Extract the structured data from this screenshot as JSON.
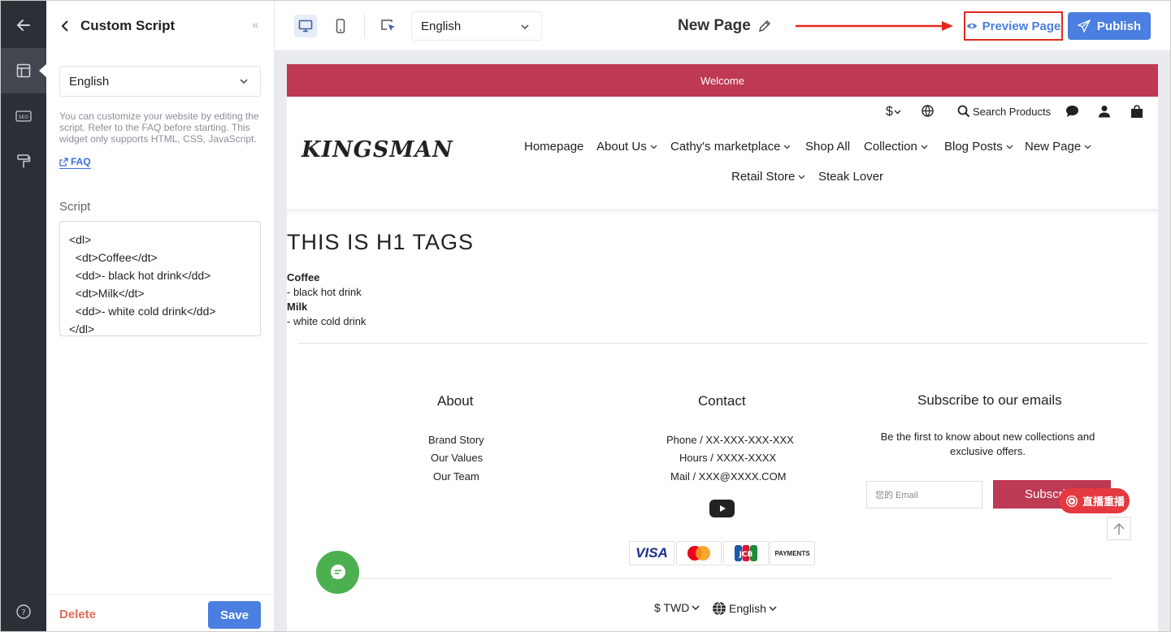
{
  "rail": {
    "items": [
      {
        "icon": "back-arrow-icon"
      },
      {
        "icon": "layout-icon"
      },
      {
        "icon": "seo-icon",
        "label": "SEO"
      },
      {
        "icon": "paint-roller-icon"
      },
      {
        "icon": "help-circle-icon"
      }
    ]
  },
  "panel": {
    "title": "Custom Script",
    "language": "English",
    "help_text": "You can customize your website by editing the script. Refer to the FAQ before starting. This widget only supports HTML, CSS, JavaScript.",
    "faq_label": "FAQ",
    "script_label": "Script",
    "script_value": "<dl>\n  <dt>Coffee</dt>\n  <dd>- black hot drink</dd>\n  <dt>Milk</dt>\n  <dd>- white cold drink</dd>\n</dl>",
    "delete_label": "Delete",
    "save_label": "Save"
  },
  "topbar": {
    "language": "English",
    "page_name": "New Page",
    "preview_label": "Preview Page",
    "publish_label": "Publish"
  },
  "site": {
    "announcement": "Welcome",
    "currency_symbol": "$",
    "search_label": "Search Products",
    "logo": "KINGSMAN",
    "nav": [
      {
        "label": "Homepage",
        "has_dropdown": false
      },
      {
        "label": "About Us",
        "has_dropdown": true
      },
      {
        "label": "Cathy's marketplace",
        "has_dropdown": true
      },
      {
        "label": "Shop All",
        "has_dropdown": false
      },
      {
        "label": "Collection",
        "has_dropdown": true
      },
      {
        "label": "Blog Posts",
        "has_dropdown": true
      },
      {
        "label": "New Page",
        "has_dropdown": true
      },
      {
        "label": "Retail Store",
        "has_dropdown": true
      },
      {
        "label": "Steak Lover",
        "has_dropdown": false
      }
    ],
    "h1": "THIS IS H1 TAGS",
    "dl": [
      {
        "term": "Coffee",
        "desc": "- black hot drink"
      },
      {
        "term": "Milk",
        "desc": "- white cold drink"
      }
    ],
    "footer": {
      "about_title": "About",
      "about_links": [
        "Brand Story",
        "Our Values",
        "Our Team"
      ],
      "contact_title": "Contact",
      "contact_lines": [
        "Phone / XX-XXX-XXX-XXX",
        "Hours / XXXX-XXXX",
        "Mail / XXX@XXXX.COM"
      ],
      "subscribe_title": "Subscribe to our emails",
      "subscribe_desc": "Be the first to know about new collections and exclusive offers.",
      "email_placeholder": "您的 Email",
      "subscribe_btn": "Subscri",
      "live_badge": "直播重播",
      "payments": [
        "VISA",
        "Mastercard",
        "JCB",
        "PAYMENTS"
      ],
      "currency": "$ TWD",
      "language": "English"
    }
  },
  "colors": {
    "accent": "#4a7ee0",
    "brand": "#bd3954",
    "highlight": "#e02a1f",
    "chat": "#4caf50"
  }
}
